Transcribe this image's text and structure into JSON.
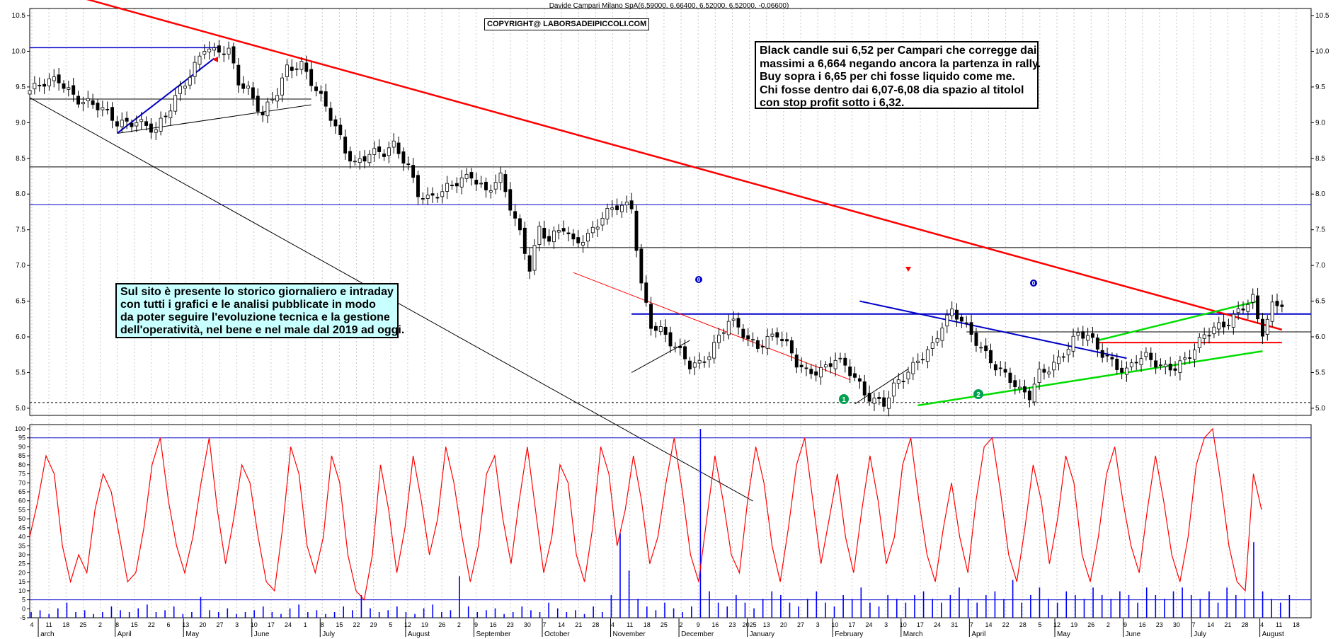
{
  "header": {
    "title": "Davide Campari Milano SpA(6.59000, 6.66400, 6.52000, 6.52000, -0.06600)",
    "copyright": "COPYRIGHT@ LABORSADEIPICCOLI.COM"
  },
  "annotations": {
    "main_lines": [
      "Black candle sui 6,52 per Campari che corregge dai",
      "massimi a 6,664 negando ancora la partenza in rally.",
      "Buy sopra i 6,65 per chi fosse liquido come me.",
      "Chi fosse dentro dai 6,07-6,08 dia spazio al titolol",
      "con stop profit sotto i 6,32."
    ],
    "site_lines": [
      "Sul sito è presente lo storico giornaliero e intraday",
      "con tutti i grafici e le analisi pubblicate in modo",
      "da poter seguire l'evoluzione tecnica e la gestione",
      "dell'operatività, nel bene e nel male dal 2019 ad oggi."
    ],
    "markers": [
      "1",
      "2",
      "0",
      "0"
    ]
  },
  "colors": {
    "downtrend": "#ff0000",
    "support_resistance": "#0000c8",
    "trendline_green": "#00dd00",
    "candle_up": "#ffffff",
    "candle_down": "#000000",
    "oscillator": "#ff0000",
    "volume": "#0000ff",
    "marker_green": "#00a050"
  },
  "chart_data": [
    {
      "type": "candlestick",
      "ylim": [
        4.9,
        10.5
      ],
      "y_ticks": [
        "5.0",
        "5.5",
        "6.0",
        "6.5",
        "7.0",
        "7.5",
        "8.0",
        "8.5",
        "9.0",
        "9.5",
        "10.0",
        "10.5"
      ],
      "x_tick_labels": [
        "4",
        "11",
        "18",
        "25",
        "2",
        "8",
        "15",
        "22",
        "6",
        "13",
        "20",
        "27",
        "3",
        "10",
        "17",
        "24",
        "1",
        "8",
        "15",
        "22",
        "29",
        "5",
        "12",
        "19",
        "26",
        "2",
        "9",
        "16",
        "23",
        "30",
        "7",
        "14",
        "21",
        "28",
        "4",
        "11",
        "18",
        "25",
        "2",
        "9",
        "16",
        "23",
        "2025",
        "13",
        "20",
        "27",
        "3",
        "10",
        "17",
        "24",
        "3",
        "10",
        "17",
        "24",
        "31",
        "7",
        "14",
        "22",
        "28",
        "5",
        "12",
        "19",
        "26",
        "2",
        "9",
        "16",
        "23",
        "30",
        "7",
        "14",
        "21",
        "28",
        "4",
        "11",
        "18"
      ],
      "month_labels": [
        "arch",
        "April",
        "May",
        "June",
        "July",
        "August",
        "September",
        "October",
        "November",
        "December",
        "January",
        "February",
        "March",
        "April",
        "May",
        "June",
        "July",
        "August"
      ],
      "horizontal_levels": [
        10.05,
        9.33,
        8.38,
        7.85,
        7.25,
        6.32,
        6.07,
        5.92,
        5.08
      ],
      "close_path": [
        [
          0,
          9.45
        ],
        [
          6,
          9.6
        ],
        [
          10,
          9.35
        ],
        [
          14,
          9.2
        ],
        [
          18,
          9.0
        ],
        [
          22,
          9.05
        ],
        [
          26,
          8.85
        ],
        [
          29,
          9.2
        ],
        [
          31,
          9.5
        ],
        [
          33,
          9.7
        ],
        [
          36,
          10.05
        ],
        [
          38,
          9.95
        ],
        [
          41,
          10.0
        ],
        [
          43,
          9.6
        ],
        [
          45,
          9.5
        ],
        [
          46,
          9.35
        ],
        [
          48,
          9.1
        ],
        [
          51,
          9.4
        ],
        [
          53,
          9.75
        ],
        [
          56,
          9.85
        ],
        [
          58,
          9.6
        ],
        [
          61,
          9.2
        ],
        [
          63,
          8.9
        ],
        [
          65,
          8.6
        ],
        [
          67,
          8.45
        ],
        [
          70,
          8.6
        ],
        [
          73,
          8.55
        ],
        [
          75,
          8.65
        ],
        [
          78,
          8.4
        ],
        [
          80,
          8.05
        ],
        [
          82,
          7.95
        ],
        [
          85,
          8.0
        ],
        [
          88,
          8.15
        ],
        [
          91,
          8.3
        ],
        [
          94,
          8.05
        ],
        [
          97,
          8.2
        ],
        [
          99,
          7.8
        ],
        [
          101,
          7.45
        ],
        [
          103,
          7.0
        ],
        [
          105,
          7.55
        ],
        [
          107,
          7.35
        ],
        [
          110,
          7.5
        ],
        [
          112,
          7.3
        ],
        [
          115,
          7.45
        ],
        [
          118,
          7.7
        ],
        [
          121,
          7.8
        ],
        [
          124,
          7.8
        ],
        [
          126,
          6.75
        ],
        [
          128,
          6.2
        ],
        [
          130,
          6.1
        ],
        [
          132,
          5.9
        ],
        [
          134,
          5.75
        ],
        [
          136,
          5.6
        ],
        [
          138,
          5.65
        ],
        [
          140,
          5.8
        ],
        [
          142,
          6.0
        ],
        [
          144,
          6.2
        ],
        [
          146,
          6.1
        ],
        [
          148,
          5.95
        ],
        [
          150,
          5.9
        ],
        [
          152,
          6.0
        ],
        [
          154,
          6.05
        ],
        [
          156,
          5.85
        ],
        [
          158,
          5.6
        ],
        [
          160,
          5.5
        ],
        [
          162,
          5.55
        ],
        [
          164,
          5.6
        ],
        [
          166,
          5.7
        ],
        [
          168,
          5.55
        ],
        [
          170,
          5.4
        ],
        [
          172,
          5.2
        ],
        [
          174,
          5.15
        ],
        [
          176,
          5.1
        ],
        [
          178,
          5.3
        ],
        [
          180,
          5.4
        ],
        [
          182,
          5.55
        ],
        [
          184,
          5.75
        ],
        [
          186,
          5.9
        ],
        [
          188,
          6.2
        ],
        [
          190,
          6.35
        ],
        [
          192,
          6.2
        ],
        [
          194,
          6.0
        ],
        [
          196,
          5.85
        ],
        [
          198,
          5.7
        ],
        [
          200,
          5.55
        ],
        [
          202,
          5.4
        ],
        [
          204,
          5.2
        ],
        [
          206,
          5.15
        ],
        [
          208,
          5.5
        ],
        [
          210,
          5.6
        ],
        [
          212,
          5.7
        ],
        [
          214,
          5.85
        ],
        [
          216,
          6.0
        ],
        [
          218,
          6.0
        ],
        [
          220,
          5.85
        ],
        [
          222,
          5.75
        ],
        [
          224,
          5.6
        ],
        [
          226,
          5.5
        ],
        [
          228,
          5.65
        ],
        [
          230,
          5.7
        ],
        [
          232,
          5.65
        ],
        [
          234,
          5.6
        ],
        [
          236,
          5.6
        ],
        [
          238,
          5.65
        ],
        [
          240,
          5.8
        ],
        [
          242,
          6.0
        ],
        [
          244,
          6.15
        ],
        [
          246,
          6.2
        ],
        [
          248,
          6.3
        ],
        [
          250,
          6.4
        ],
        [
          252,
          6.5
        ],
        [
          253,
          6.2
        ],
        [
          254,
          6.05
        ],
        [
          256,
          6.45
        ],
        [
          258,
          6.52
        ]
      ],
      "series": [
        {
          "name": "",
          "type": "line",
          "values_desc": "downtrend",
          "x": [
            0,
            258
          ],
          "y": [
            10.95,
            6.1
          ]
        },
        {
          "name": "",
          "type": "line",
          "x": [
            0,
            149
          ],
          "y": [
            9.35,
            3.7
          ]
        },
        {
          "name": "",
          "type": "line",
          "x": [
            18,
            58
          ],
          "y": [
            8.85,
            9.25
          ]
        },
        {
          "name": "",
          "type": "line",
          "x": [
            18,
            38
          ],
          "y": [
            8.85,
            9.9
          ]
        },
        {
          "name": "",
          "type": "line",
          "x": [
            112,
            169
          ],
          "y": [
            6.9,
            5.4
          ]
        },
        {
          "name": "",
          "type": "line",
          "x": [
            124,
            136
          ],
          "y": [
            5.5,
            5.95
          ]
        },
        {
          "name": "",
          "type": "line",
          "x": [
            170,
            181
          ],
          "y": [
            5.06,
            5.55
          ]
        },
        {
          "name": "",
          "type": "line",
          "x": [
            171,
            226
          ],
          "y": [
            6.5,
            5.7
          ]
        },
        {
          "name": "",
          "type": "line",
          "x": [
            183,
            254
          ],
          "y": [
            5.04,
            5.8
          ]
        },
        {
          "name": "",
          "type": "line",
          "x": [
            220,
            253
          ],
          "y": [
            5.95,
            6.5
          ]
        }
      ]
    },
    {
      "type": "line",
      "ylim": [
        -5,
        100
      ],
      "y_ticks": [
        "-5",
        "0",
        "5",
        "10",
        "15",
        "20",
        "25",
        "30",
        "35",
        "40",
        "45",
        "50",
        "55",
        "60",
        "65",
        "70",
        "75",
        "80",
        "85",
        "90",
        "95",
        "100"
      ],
      "series": [
        {
          "name": "",
          "values": [
            40,
            60,
            85,
            75,
            35,
            15,
            30,
            20,
            55,
            75,
            65,
            40,
            15,
            20,
            45,
            80,
            95,
            60,
            35,
            20,
            40,
            70,
            95,
            55,
            25,
            50,
            80,
            70,
            40,
            15,
            10,
            45,
            90,
            75,
            35,
            20,
            40,
            85,
            70,
            30,
            10,
            5,
            30,
            80,
            55,
            20,
            45,
            85,
            60,
            30,
            50,
            90,
            70,
            40,
            15,
            35,
            75,
            85,
            50,
            25,
            60,
            90,
            55,
            20,
            40,
            80,
            70,
            30,
            15,
            45,
            90,
            75,
            35,
            55,
            85,
            60,
            25,
            40,
            70,
            95,
            65,
            30,
            15,
            50,
            85,
            60,
            30,
            20,
            60,
            90,
            70,
            35,
            15,
            45,
            80,
            95,
            60,
            25,
            50,
            75,
            40,
            20,
            55,
            85,
            60,
            25,
            40,
            80,
            95,
            60,
            30,
            15,
            45,
            70,
            40,
            20,
            60,
            90,
            95,
            65,
            30,
            15,
            45,
            80,
            60,
            25,
            50,
            85,
            70,
            30,
            15,
            40,
            75,
            90,
            60,
            35,
            20,
            55,
            85,
            60,
            30,
            15,
            40,
            80,
            95,
            100,
            70,
            35,
            15,
            10,
            75,
            55
          ]
        },
        {
          "name": "",
          "type": "bar",
          "values": [
            3,
            4,
            2,
            5,
            8,
            3,
            4,
            2,
            3,
            6,
            4,
            3,
            5,
            7,
            3,
            4,
            6,
            2,
            3,
            11,
            4,
            3,
            5,
            2,
            3,
            4,
            6,
            3,
            2,
            5,
            7,
            3,
            4,
            2,
            3,
            6,
            4,
            12,
            5,
            3,
            4,
            6,
            3,
            2,
            5,
            7,
            3,
            4,
            22,
            6,
            3,
            4,
            5,
            2,
            3,
            6,
            4,
            3,
            8,
            5,
            3,
            4,
            2,
            6,
            3,
            12,
            45,
            25,
            10,
            6,
            4,
            8,
            5,
            3,
            6,
            100,
            14,
            8,
            6,
            12,
            8,
            5,
            10,
            14,
            12,
            8,
            6,
            10,
            14,
            8,
            6,
            12,
            10,
            16,
            8,
            6,
            12,
            10,
            8,
            12,
            14,
            10,
            8,
            12,
            16,
            10,
            8,
            12,
            14,
            10,
            20,
            8,
            12,
            16,
            10,
            8,
            14,
            12,
            10,
            16,
            12,
            10,
            14,
            12,
            8,
            16,
            12,
            10,
            14,
            16,
            12,
            10,
            14,
            8,
            16,
            12,
            10,
            40,
            14,
            10,
            8,
            12
          ]
        }
      ]
    }
  ]
}
